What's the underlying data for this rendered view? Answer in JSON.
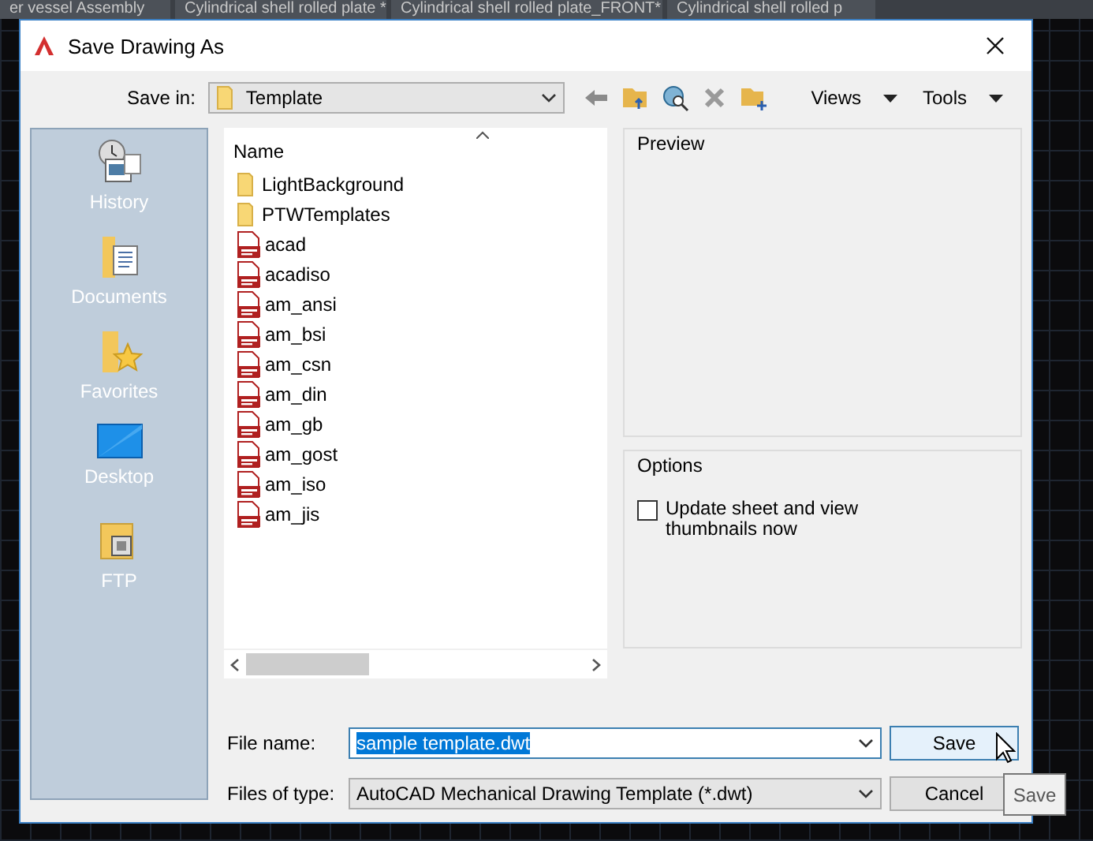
{
  "background_tabs": [
    {
      "label": "er vessel Assembly"
    },
    {
      "label": "Cylindrical shell rolled plate *"
    },
    {
      "label": "Cylindrical shell rolled plate_FRONT*"
    },
    {
      "label": "Cylindrical shell rolled p"
    }
  ],
  "dialog": {
    "title": "Save Drawing As",
    "save_in": {
      "label": "Save in:",
      "value": "Template"
    },
    "toolbar_menus": [
      "Views",
      "Tools"
    ],
    "places": [
      {
        "label": "History",
        "kind": "history"
      },
      {
        "label": "Documents",
        "kind": "documents"
      },
      {
        "label": "Favorites",
        "kind": "favorites"
      },
      {
        "label": "Desktop",
        "kind": "desktop"
      },
      {
        "label": "FTP",
        "kind": "ftp"
      }
    ],
    "file_list": {
      "column": "Name",
      "items": [
        {
          "name": "LightBackground",
          "kind": "folder"
        },
        {
          "name": "PTWTemplates",
          "kind": "folder"
        },
        {
          "name": "acad",
          "kind": "dwt"
        },
        {
          "name": "acadiso",
          "kind": "dwt"
        },
        {
          "name": "am_ansi",
          "kind": "dwt"
        },
        {
          "name": "am_bsi",
          "kind": "dwt"
        },
        {
          "name": "am_csn",
          "kind": "dwt"
        },
        {
          "name": "am_din",
          "kind": "dwt"
        },
        {
          "name": "am_gb",
          "kind": "dwt"
        },
        {
          "name": "am_gost",
          "kind": "dwt"
        },
        {
          "name": "am_iso",
          "kind": "dwt"
        },
        {
          "name": "am_jis",
          "kind": "dwt"
        }
      ]
    },
    "preview": {
      "label": "Preview"
    },
    "options": {
      "label": "Options",
      "checkbox": {
        "label": "Update sheet and view thumbnails now",
        "checked": false
      }
    },
    "file_name": {
      "label": "File name:",
      "value": "sample template.dwt"
    },
    "file_type": {
      "label": "Files of type:",
      "value": "AutoCAD Mechanical Drawing Template (*.dwt)"
    },
    "buttons": [
      "Save",
      "Cancel"
    ],
    "tooltip": "Save"
  }
}
